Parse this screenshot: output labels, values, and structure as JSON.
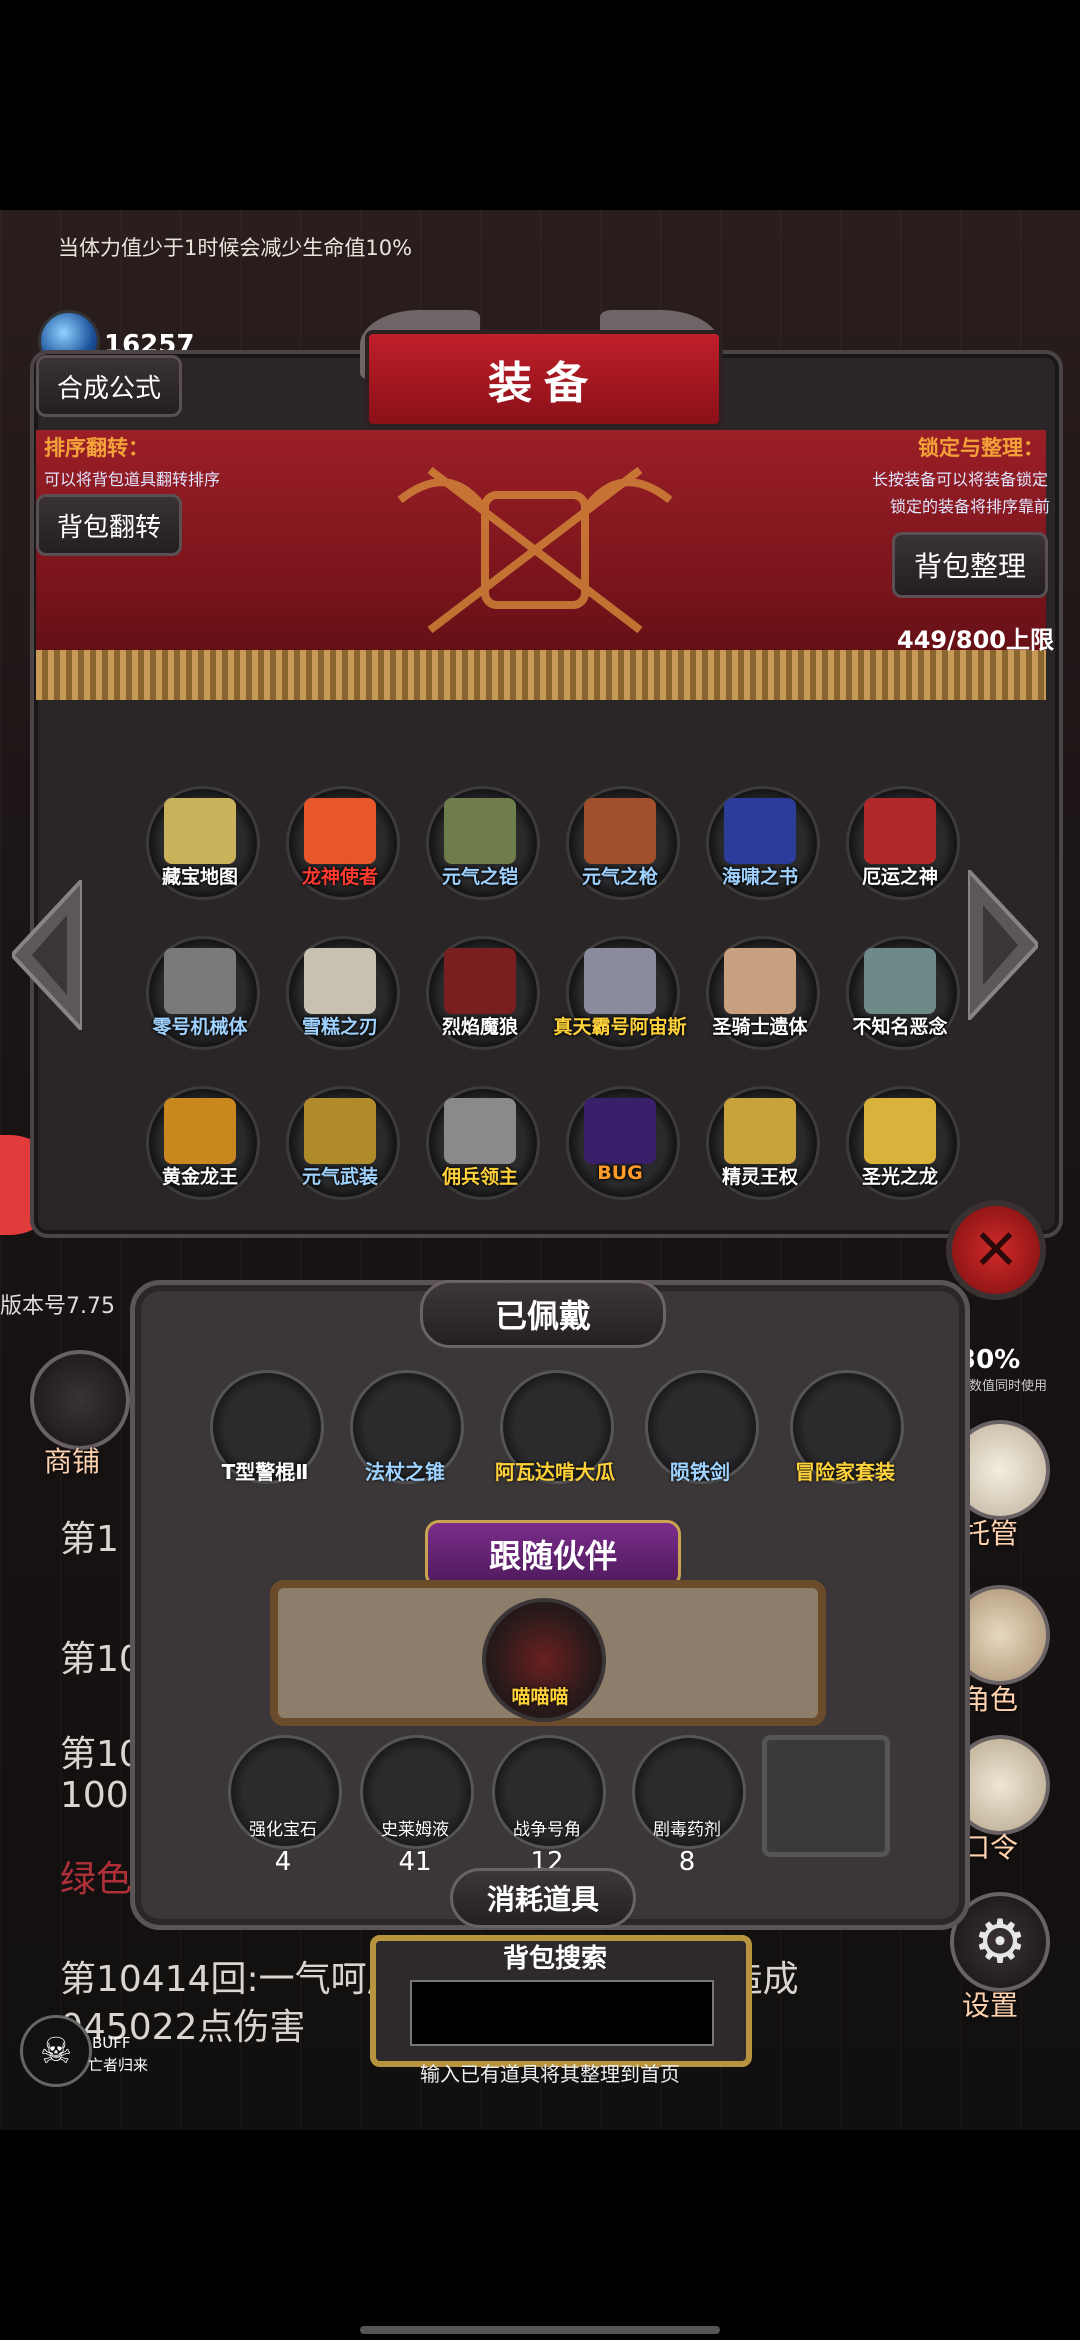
{
  "hint": "当体力值少于1时候会减少生命值10%",
  "gems": "16257",
  "version": "版本号7.75",
  "window_title": "装备",
  "buttons": {
    "formula": "合成公式",
    "flip": "背包翻转",
    "organize": "背包整理"
  },
  "tips": {
    "left_title": "排序翻转：",
    "left_text": "可以将背包道具翻转排序",
    "right_title": "锁定与整理：",
    "right_line1": "长按装备可以将装备锁定",
    "right_line2": "锁定的装备将排序靠前"
  },
  "capacity": "449/800上限",
  "items": [
    {
      "label": "藏宝地图",
      "color": "#ffffff",
      "art": "#c9b25a"
    },
    {
      "label": "龙神使者",
      "color": "#ff3b30",
      "art": "#e8572a"
    },
    {
      "label": "元气之铠",
      "color": "#9fd2ff",
      "art": "#6f7d4c"
    },
    {
      "label": "元气之枪",
      "color": "#9fd2ff",
      "art": "#a0502a"
    },
    {
      "label": "海啸之书",
      "color": "#9fd2ff",
      "art": "#2b3c9a"
    },
    {
      "label": "厄运之神",
      "color": "#ffffff",
      "art": "#b0282a"
    },
    {
      "label": "零号机械体",
      "color": "#9fd2ff",
      "art": "#7a7a7a"
    },
    {
      "label": "雪糕之刃",
      "color": "#9fd2ff",
      "art": "#c8c0b0"
    },
    {
      "label": "烈焰魔狼",
      "color": "#ffffff",
      "art": "#7a1e1e"
    },
    {
      "label": "真天霸号阿宙斯",
      "color": "#ffd23a",
      "art": "#8b8ba0"
    },
    {
      "label": "圣骑士遗体",
      "color": "#ffffff",
      "art": "#c8a080"
    },
    {
      "label": "不知名恶念",
      "color": "#ffffff",
      "art": "#6d8a88"
    },
    {
      "label": "黄金龙王",
      "color": "#ffffff",
      "art": "#c8881e"
    },
    {
      "label": "元气武装",
      "color": "#9fd2ff",
      "art": "#b08b2a"
    },
    {
      "label": "佣兵领主",
      "color": "#ffd23a",
      "art": "#8a8a8a"
    },
    {
      "label": "BUG",
      "color": "#ff9b2a",
      "art": "#3a1f6a"
    },
    {
      "label": "精灵王权",
      "color": "#ffffff",
      "art": "#c8a23a"
    },
    {
      "label": "圣光之龙",
      "color": "#ffffff",
      "art": "#d8b23a"
    }
  ],
  "equipped": {
    "title": "已佩戴",
    "items": [
      {
        "label": "T型警棍Ⅱ",
        "color": "#ffffff"
      },
      {
        "label": "法杖之锥",
        "color": "#9fd2ff"
      },
      {
        "label": "阿瓦达啃大瓜",
        "color": "#ffd23a"
      },
      {
        "label": "陨铁剑",
        "color": "#9fd2ff"
      },
      {
        "label": "冒险家套装",
        "color": "#ffd23a"
      }
    ]
  },
  "companion": {
    "title": "跟随伙伴",
    "name": "喵喵喵"
  },
  "consumables": {
    "title": "消耗道具",
    "items": [
      {
        "label": "强化宝石",
        "count": "4"
      },
      {
        "label": "史莱姆液",
        "count": "41"
      },
      {
        "label": "战争号角",
        "count": "12"
      },
      {
        "label": "剧毒药剂",
        "count": "8"
      }
    ]
  },
  "search": {
    "title": "背包搜索",
    "hint": "输入已有道具将其整理到首页"
  },
  "side_menu": {
    "shop": "商铺",
    "manage": "托管",
    "role": "角色",
    "code": "口令",
    "settings": "设置",
    "stat": "30%",
    "stat_note": "其数值同时使用"
  },
  "log": {
    "line1": "第1",
    "line2": "第104",
    "line3a": "第10",
    "line3b": "100",
    "line4": "绿色",
    "line5": "第10414回:一气呵成正使用了绿色史莱姆造成",
    "line6": "045022点伤害"
  },
  "buff": {
    "title": "BUFF",
    "name": "亡者归来"
  }
}
